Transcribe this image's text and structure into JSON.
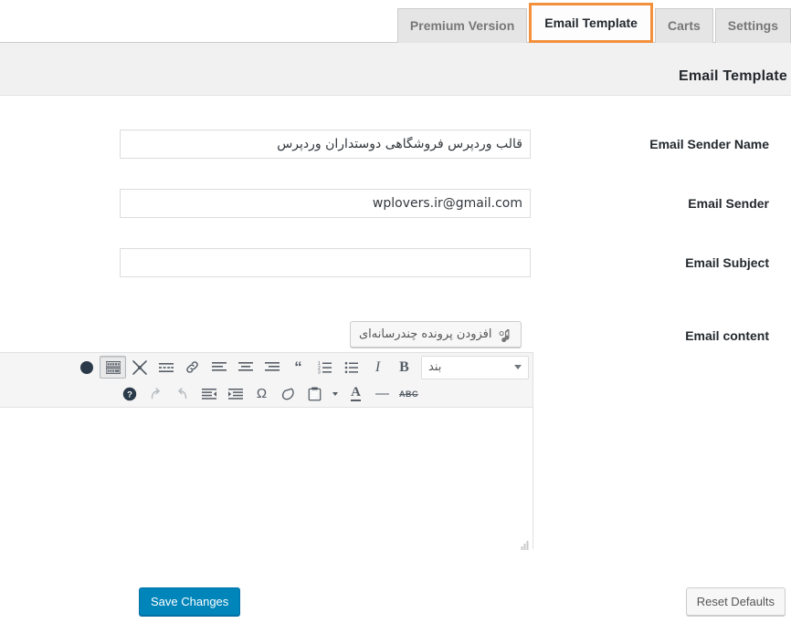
{
  "tabs": [
    {
      "label": "Premium Version",
      "active": false
    },
    {
      "label": "Email Template",
      "active": true
    },
    {
      "label": "Carts",
      "active": false
    },
    {
      "label": "Settings",
      "active": false
    }
  ],
  "header": {
    "title": "Email Template"
  },
  "colors": {
    "active_tab_outline": "#f2903c",
    "primary_button": "#0085ba",
    "header_band": "#f1f1f1",
    "tab_inactive": "#e5e5e5",
    "border": "#cccccc"
  },
  "fields": [
    {
      "label": "Email Sender Name",
      "value": "قالب وردپرس فروشگاهی دوستداران وردپرس",
      "placeholder": "",
      "dir": "rtl"
    },
    {
      "label": "Email Sender",
      "value": "wplovers.ir@gmail.com",
      "placeholder": "",
      "dir": "ltr"
    },
    {
      "label": "Email Subject",
      "value": "",
      "placeholder": "",
      "dir": "rtl"
    }
  ],
  "content_field": {
    "label": "Email content",
    "add_media_label": "افزودن پرونده چندرسانه‌ای",
    "add_media_icon": "media-icon",
    "body_text": ""
  },
  "editor": {
    "format_select": {
      "value": "بند"
    },
    "toolbar_row1": [
      {
        "icon": "bold-icon",
        "glyph": "B",
        "title": "B"
      },
      {
        "icon": "italic-icon",
        "glyph": "I",
        "title": "I"
      },
      {
        "icon": "unordered-list-icon",
        "glyph": "list-ul"
      },
      {
        "icon": "ordered-list-icon",
        "glyph": "list-ol"
      },
      {
        "icon": "blockquote-icon",
        "glyph": "“"
      },
      {
        "icon": "align-right-icon",
        "glyph": "align-right"
      },
      {
        "icon": "align-center-icon",
        "glyph": "align-center"
      },
      {
        "icon": "align-left-icon",
        "glyph": "align-left"
      },
      {
        "icon": "link-icon",
        "glyph": "link"
      },
      {
        "icon": "read-more-icon",
        "glyph": "more"
      },
      {
        "icon": "fullscreen-icon",
        "glyph": "fullscreen"
      },
      {
        "icon": "toggle-toolbar-icon",
        "glyph": "kitchen-sink",
        "pressed": true
      }
    ],
    "toolbar_row2": [
      {
        "icon": "strikethrough-icon",
        "glyph": "ABC"
      },
      {
        "icon": "horizontal-rule-icon",
        "glyph": "—"
      },
      {
        "icon": "text-color-icon",
        "glyph": "A"
      },
      {
        "icon": "text-color-dropdown-icon",
        "glyph": "caret"
      },
      {
        "icon": "paste-as-text-icon",
        "glyph": "clipboard"
      },
      {
        "icon": "clear-formatting-icon",
        "glyph": "eraser"
      },
      {
        "icon": "special-character-icon",
        "glyph": "Ω"
      },
      {
        "icon": "indent-icon",
        "glyph": "indent"
      },
      {
        "icon": "outdent-icon",
        "glyph": "outdent"
      },
      {
        "icon": "undo-icon",
        "glyph": "undo"
      },
      {
        "icon": "redo-icon",
        "glyph": "redo"
      },
      {
        "icon": "keyboard-shortcuts-icon",
        "glyph": "help"
      }
    ]
  },
  "footer": {
    "save_label": "Save Changes",
    "reset_label": "Reset Defaults"
  }
}
